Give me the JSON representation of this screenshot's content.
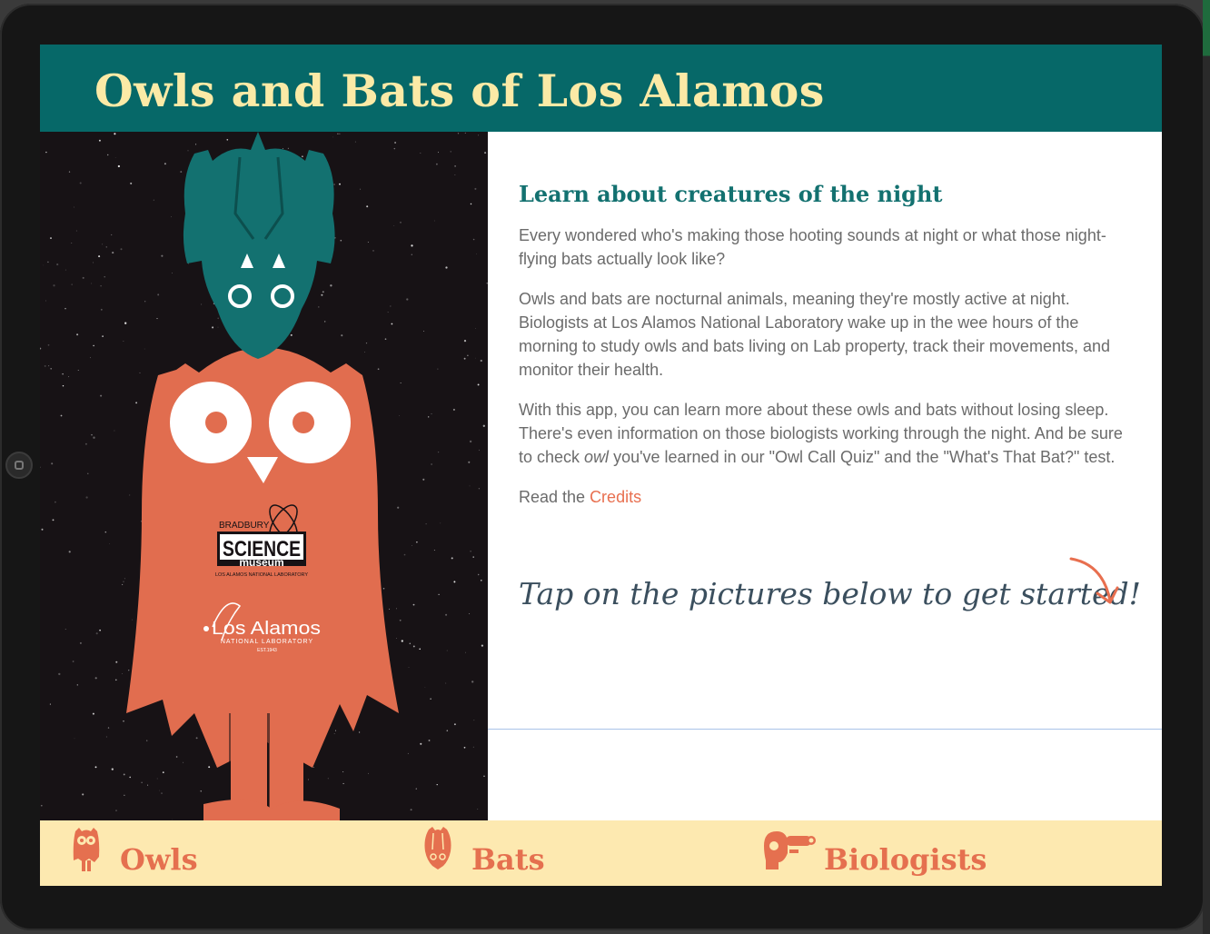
{
  "app": {
    "title": "Owls and Bats of Los Alamos"
  },
  "hero": {
    "museum_logo": {
      "top_text": "BRADBURY",
      "main_text": "SCIENCE",
      "sub_text": "museum",
      "bottom_text": "LOS ALAMOS NATIONAL LABORATORY"
    },
    "lab_logo": {
      "main_text": "Los Alamos",
      "sub_text": "NATIONAL LABORATORY",
      "est_text": "EST.1943"
    }
  },
  "content": {
    "heading": "Learn about creatures of the night",
    "paragraph1": "Every wondered who's making those hooting sounds at night or what those night-flying bats actually look like?",
    "paragraph2": "Owls and bats are nocturnal animals, meaning they're mostly active at night. Biologists at Los Alamos National Laboratory wake up in the wee hours of the morning to study owls and bats living on Lab property, track their movements, and monitor their health.",
    "paragraph3_part1": "With this app, you can learn more about these owls and bats without losing sleep. There's even information on those biologists working through the night. And be sure to check ",
    "paragraph3_em": "owl",
    "paragraph3_part2": " you've learned in our \"Owl Call Quiz\" and the \"What's That Bat?\" test.",
    "credits_prefix": "Read the ",
    "credits_link": "Credits",
    "tap_prompt": "Tap on the pictures below to get started!"
  },
  "nav": {
    "owls_label": "Owls",
    "bats_label": "Bats",
    "biologists_label": "Biologists"
  },
  "colors": {
    "header_bg": "#066868",
    "title_text": "#fbeaa6",
    "owl_orange": "#e16d4f",
    "bat_teal": "#137170",
    "nav_bg": "#fde9b0",
    "accent": "#e86f4f"
  },
  "icons": {
    "owls": "owl-icon",
    "bats": "bat-icon",
    "biologists": "biologist-binoculars-icon",
    "arrow": "curved-arrow-icon"
  }
}
